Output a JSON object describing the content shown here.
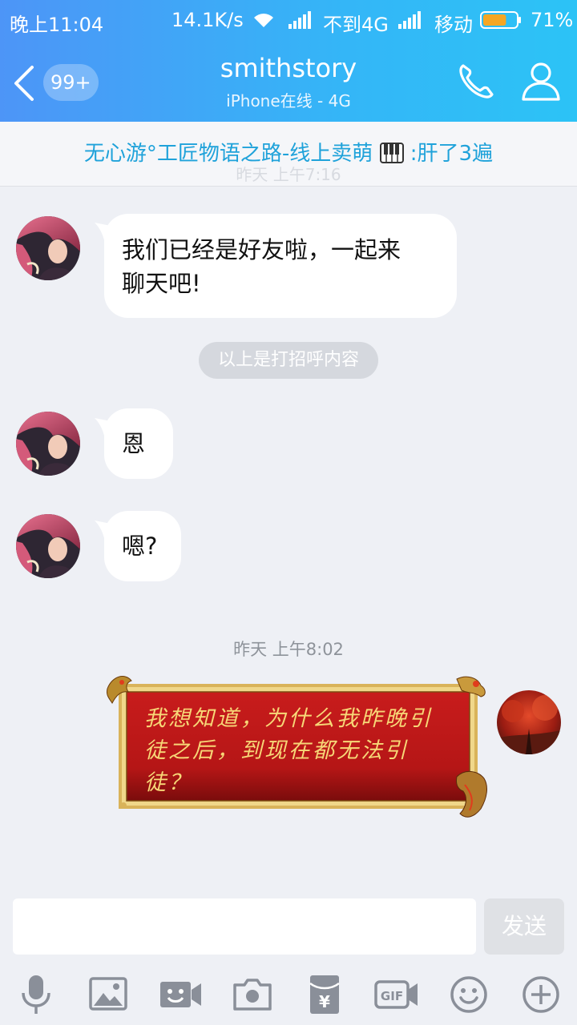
{
  "status_bar": {
    "time": "晚上11:04",
    "speed": "14.1K/s",
    "network1": "不到4G",
    "network2": "移动",
    "battery_percent": "71%",
    "battery_level": 0.71,
    "battery_color": "#f5a623"
  },
  "header": {
    "back_badge": "99+",
    "contact_name": "smithstory",
    "contact_status": "iPhone在线 - 4G",
    "call_icon": "phone-icon",
    "profile_icon": "user-icon"
  },
  "banner": {
    "text_before": "无心游°工匠物语之路-线上卖萌",
    "text_after": ":肝了3遍",
    "icon": "piano-keys-icon",
    "ghost_timestamp": "昨天 上午7:16"
  },
  "messages": [
    {
      "sender": "friend",
      "text_line1": "我们已经是好友啦，一起来",
      "text_line2": "聊天吧!"
    },
    {
      "sender": "system",
      "text": "以上是打招呼内容"
    },
    {
      "sender": "friend",
      "text": "恩"
    },
    {
      "sender": "friend",
      "text": "嗯?"
    },
    {
      "sender": "system",
      "text": "昨天 上午8:02"
    },
    {
      "sender": "me",
      "text_line1": "我想知道，为什么我昨晚引",
      "text_line2": "徒之后，到现在都无法引",
      "text_line3": "徒？"
    }
  ],
  "input": {
    "placeholder": "",
    "send_label": "发送"
  },
  "toolbar": {
    "items": [
      "mic-icon",
      "image-icon",
      "video-chat-icon",
      "camera-icon",
      "red-envelope-icon",
      "gif-icon",
      "emoji-icon",
      "plus-icon"
    ]
  },
  "colors": {
    "header_gradient_start": "#4d95f7",
    "header_gradient_end": "#2cc3f6",
    "banner_text": "#1fa2da",
    "chat_background": "#eef0f5",
    "red_bubble": "#c01818",
    "red_bubble_text": "#f7d777"
  }
}
